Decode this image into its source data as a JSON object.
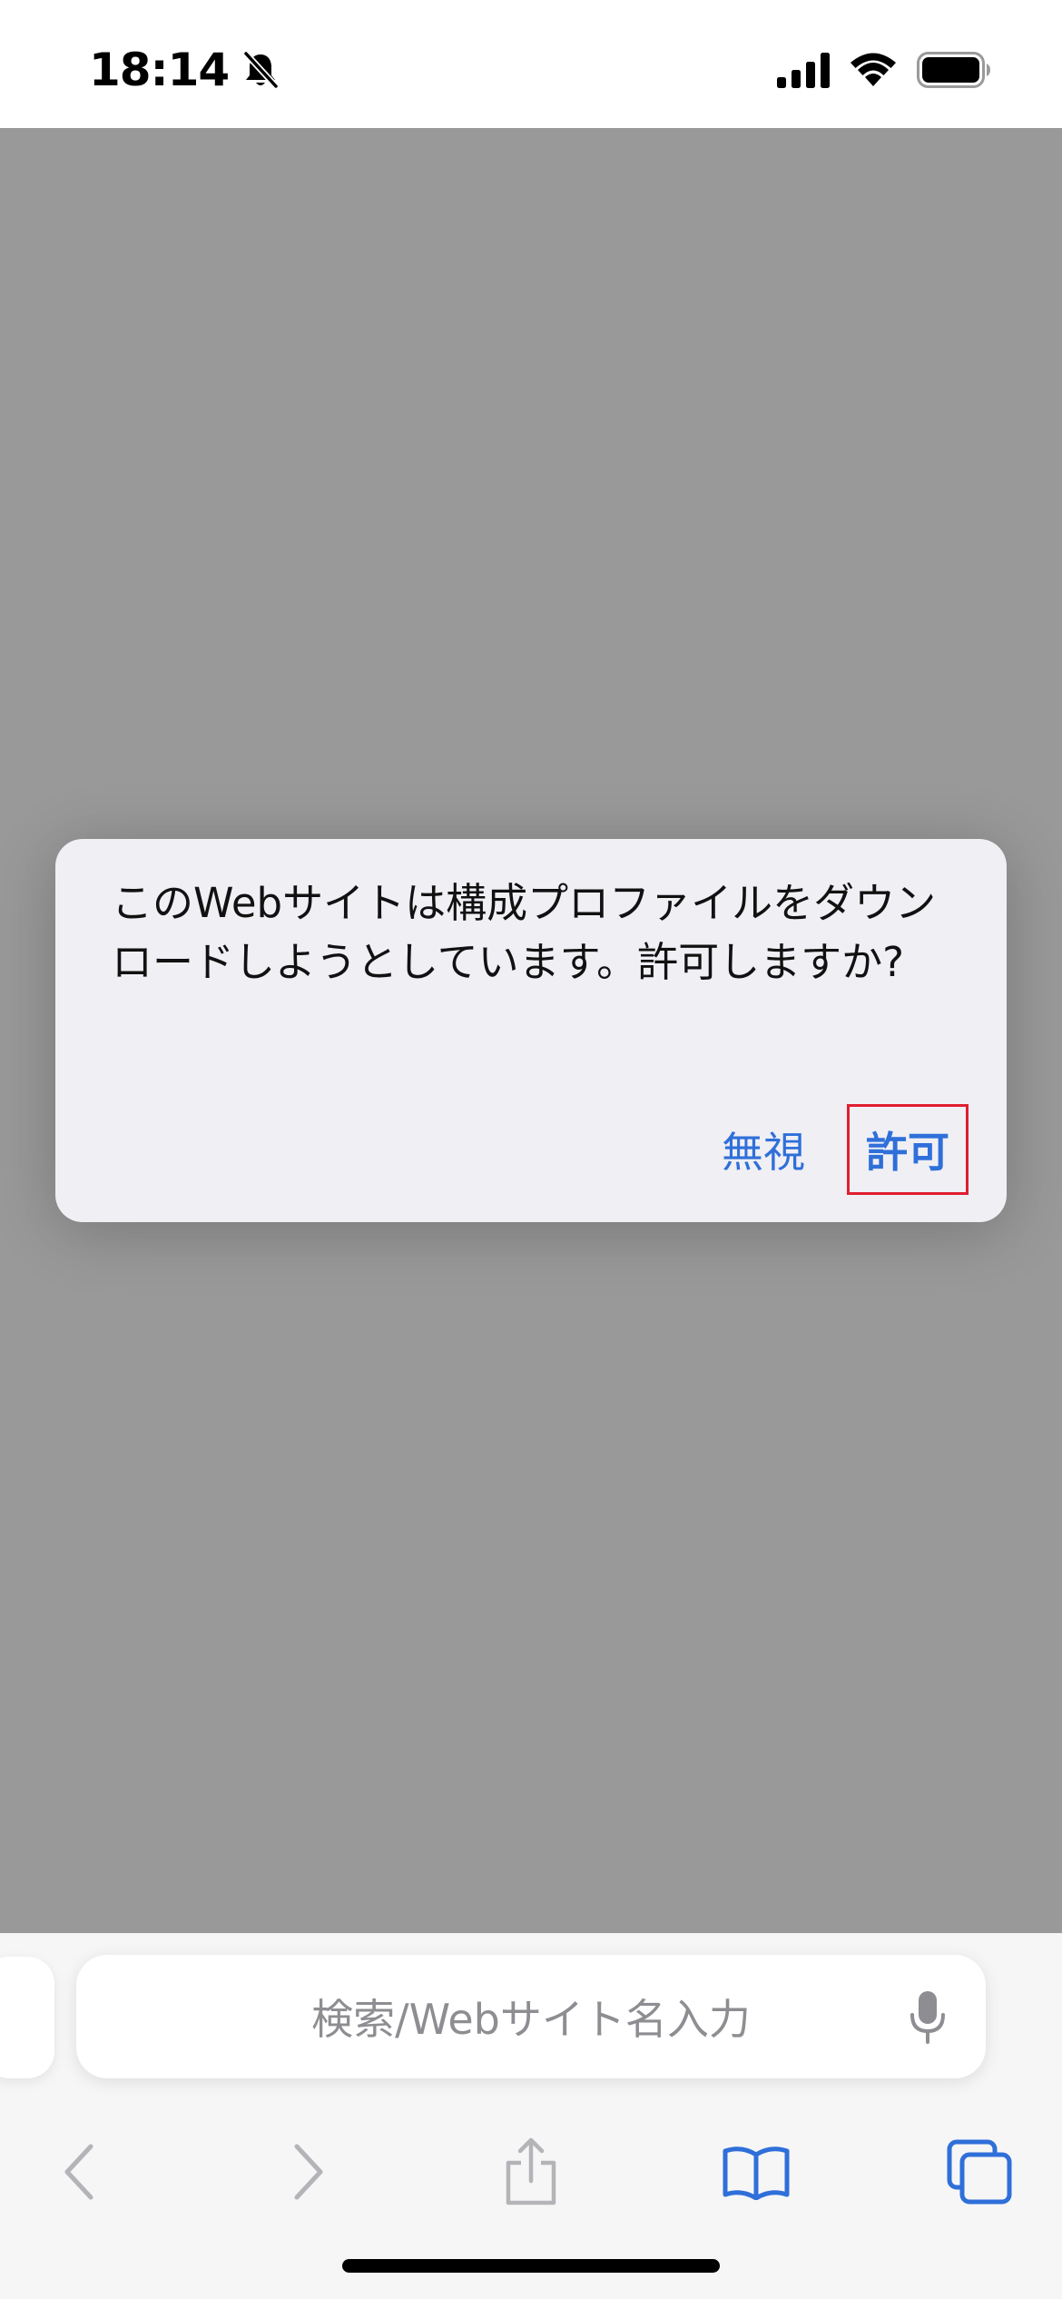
{
  "status_bar": {
    "time": "18:14",
    "icons": [
      "bell-slash-icon",
      "cellular-signal-icon",
      "wifi-icon",
      "battery-icon"
    ]
  },
  "alert": {
    "message": "このWebサイトは構成プロファイルをダウンロードしようとしています。許可しますか?",
    "ignore_label": "無視",
    "allow_label": "許可"
  },
  "toolbar": {
    "address_placeholder": "検索/Webサイト名入力",
    "buttons": [
      "back-icon",
      "forward-icon",
      "share-icon",
      "bookmarks-icon",
      "tabs-icon"
    ]
  },
  "colors": {
    "accent": "#2f6fd9",
    "highlight_box": "#e01e30",
    "dim_overlay": "#999999",
    "disabled_icon": "#b4b4b8"
  }
}
